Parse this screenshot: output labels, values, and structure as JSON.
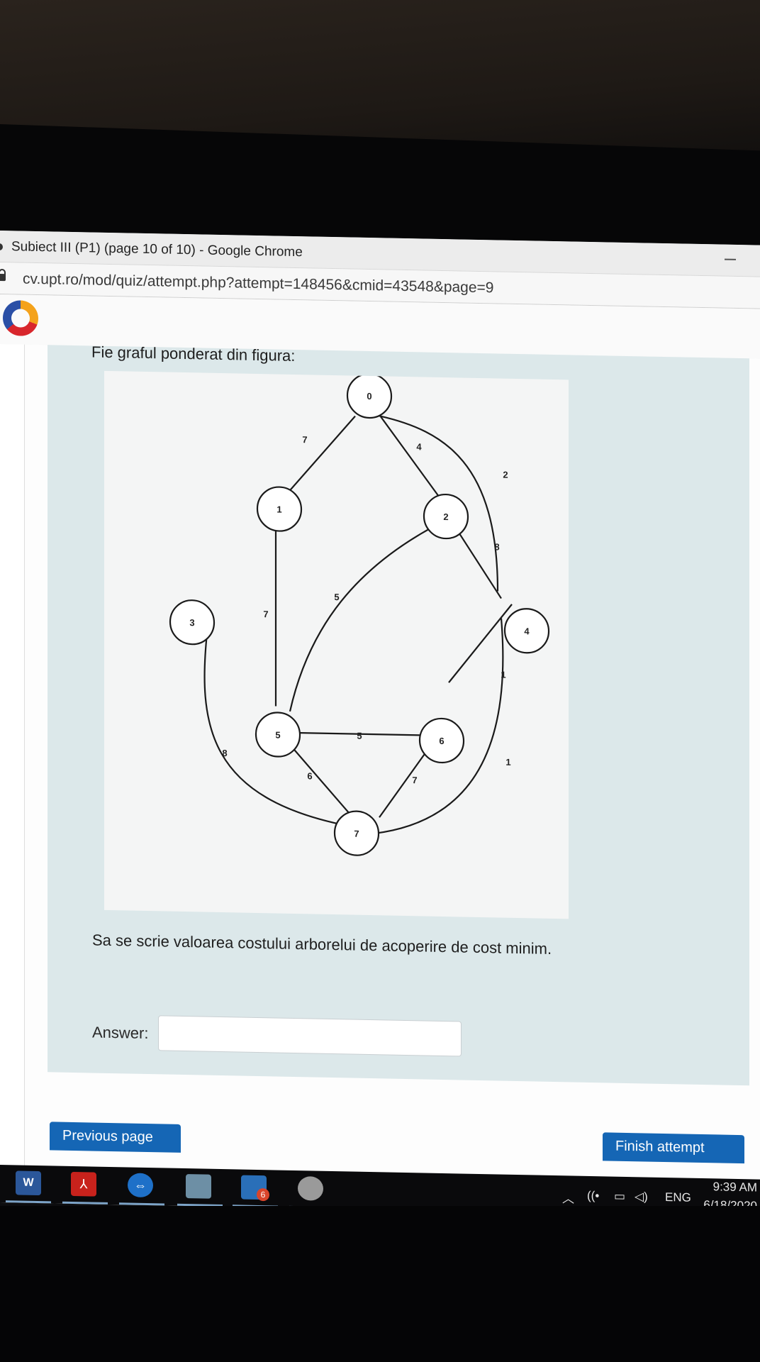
{
  "window": {
    "title": "Subiect III (P1) (page 10 of 10) - Google Chrome",
    "url": "cv.upt.ro/mod/quiz/attempt.php?attempt=148456&cmid=43548&page=9"
  },
  "question": {
    "intro": "Fie graful ponderat din figura:",
    "prompt": "Sa se scrie valoarea costului arborelui de acoperire de cost minim.",
    "answer_label": "Answer:",
    "answer_value": ""
  },
  "graph": {
    "nodes": [
      "0",
      "1",
      "2",
      "3",
      "4",
      "5",
      "6",
      "7"
    ],
    "edges": [
      {
        "from": "0",
        "to": "1",
        "weight": "7"
      },
      {
        "from": "0",
        "to": "2",
        "weight": "4"
      },
      {
        "from": "0",
        "to": "4",
        "weight": "2"
      },
      {
        "from": "2",
        "to": "4",
        "weight": "8"
      },
      {
        "from": "2",
        "to": "5",
        "weight": "5"
      },
      {
        "from": "1",
        "to": "5",
        "weight": "7"
      },
      {
        "from": "4",
        "to": "6",
        "weight": "1"
      },
      {
        "from": "4",
        "to": "7",
        "weight": "1"
      },
      {
        "from": "5",
        "to": "6",
        "weight": "5"
      },
      {
        "from": "5",
        "to": "7",
        "weight": "6"
      },
      {
        "from": "6",
        "to": "7",
        "weight": "7"
      },
      {
        "from": "3",
        "to": "7",
        "weight": "8"
      }
    ]
  },
  "nav": {
    "previous_label": "Previous page",
    "finish_label": "Finish attempt"
  },
  "taskbar": {
    "word_glyph": "W",
    "pdf_glyph": "⅄",
    "teamviewer_glyph": "⇔",
    "outlook_badge": "6",
    "language": "ENG",
    "time": "9:39 AM",
    "date": "6/18/2020"
  }
}
